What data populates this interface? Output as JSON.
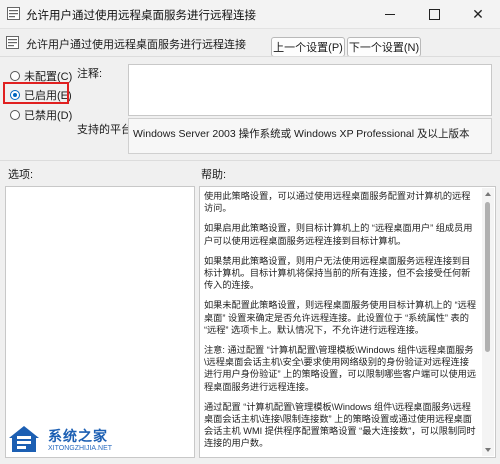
{
  "window": {
    "title": "允许用户通过使用远程桌面服务进行远程连接",
    "minimize_icon": "minimize-icon",
    "maximize_icon": "maximize-icon",
    "close_icon": "close-icon",
    "close_glyph": "✕"
  },
  "header": {
    "policy_name": "允许用户通过使用远程桌面服务进行远程连接",
    "prev_button": "上一个设置(P)",
    "next_button": "下一个设置(N)"
  },
  "state_options": [
    {
      "label": "未配置(C)",
      "selected": false
    },
    {
      "label": "已启用(E)",
      "selected": true
    },
    {
      "label": "已禁用(D)",
      "selected": false
    }
  ],
  "comment": {
    "label": "注释:",
    "value": ""
  },
  "supported": {
    "label": "支持的平台:",
    "value": "Windows Server 2003 操作系统或 Windows XP Professional 及以上版本"
  },
  "options": {
    "label": "选项:"
  },
  "help": {
    "label": "帮助:",
    "paragraphs": [
      "使用此策略设置，可以通过使用远程桌面服务配置对计算机的远程访问。",
      "如果启用此策略设置，则目标计算机上的 “远程桌面用户” 组成员用户可以使用远程桌面服务远程连接到目标计算机。",
      "如果禁用此策略设置，则用户无法使用远程桌面服务远程连接到目标计算机。目标计算机将保持当前的所有连接，但不会接受任何新传入的连接。",
      "如果未配置此策略设置，则远程桌面服务使用目标计算机上的 “远程桌面” 设置来确定是否允许远程连接。此设置位于 “系统属性” 表的 “远程” 选项卡上。默认情况下，不允许进行远程连接。",
      "注意: 通过配置 “计算机配置\\管理模板\\Windows 组件\\远程桌面服务\\远程桌面会话主机\\安全\\要求使用网络级别的身份验证对远程连接进行用户身份验证” 上的策略设置，可以限制哪些客户端可以使用远程桌面服务进行远程连接。",
      "通过配置 “计算机配置\\管理模板\\Windows 组件\\远程桌面服务\\远程桌面会话主机\\连接\\限制连接数” 上的策略设置或通过使用远程桌面会话主机 WMI 提供程序配置策略设置 “最大连接数”，可以限制同时连接的用户数。"
    ]
  },
  "watermark": {
    "brand_cn": "系统之家",
    "brand_en": "XITONGZHIJIA.NET"
  },
  "colors": {
    "accent": "#0067c0",
    "highlight": "#e02020",
    "brand": "#1c5fb3"
  }
}
